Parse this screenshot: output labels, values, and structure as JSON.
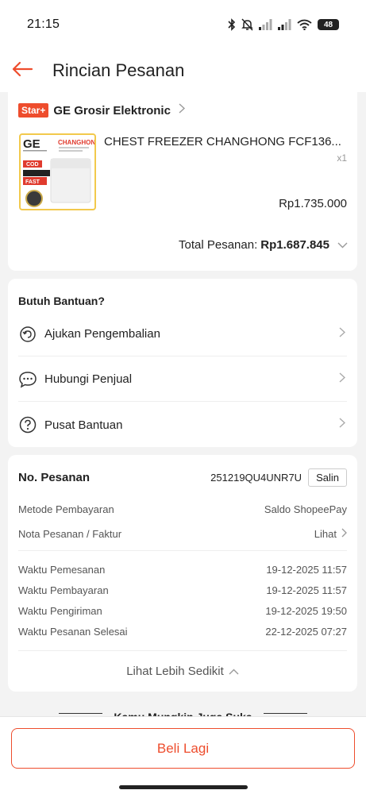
{
  "status_bar": {
    "time": "21:15",
    "battery": "48",
    "icons": [
      "bluetooth-icon",
      "bell-off-icon",
      "signal-icon",
      "signal-icon",
      "wifi-icon",
      "battery-icon"
    ]
  },
  "header": {
    "title": "Rincian Pesanan"
  },
  "shop": {
    "badge": "Star+",
    "name": "GE Grosir Elektronic"
  },
  "product": {
    "name": "CHEST FREEZER CHANGHONG FCF136...",
    "qty": "x1",
    "price": "Rp1.735.000",
    "thumb_brand": "CHANGHONG",
    "thumb_logo": "GE",
    "thumb_cod": "COD",
    "thumb_fast": "FAST"
  },
  "total": {
    "label": "Total Pesanan:",
    "amount": "Rp1.687.845"
  },
  "help": {
    "title": "Butuh Bantuan?",
    "items": [
      {
        "label": "Ajukan Pengembalian",
        "icon": "return-icon"
      },
      {
        "label": "Hubungi Penjual",
        "icon": "chat-icon"
      },
      {
        "label": "Pusat Bantuan",
        "icon": "help-icon"
      }
    ]
  },
  "order": {
    "no_label": "No. Pesanan",
    "no_value": "251219QU4UNR7U",
    "copy_label": "Salin",
    "payment_label": "Metode Pembayaran",
    "payment_value": "Saldo ShopeePay",
    "invoice_label": "Nota Pesanan / Faktur",
    "invoice_value": "Lihat",
    "times": [
      {
        "label": "Waktu Pemesanan",
        "value": "19-12-2025 11:57"
      },
      {
        "label": "Waktu Pembayaran",
        "value": "19-12-2025 11:57"
      },
      {
        "label": "Waktu Pengiriman",
        "value": "19-12-2025 19:50"
      },
      {
        "label": "Waktu Pesanan Selesai",
        "value": "22-12-2025 07:27"
      }
    ],
    "less_label": "Lihat Lebih Sedikit"
  },
  "recommend": {
    "title": "Kamu Mungkin Juga Suka"
  },
  "footer": {
    "buy_again": "Beli Lagi"
  },
  "colors": {
    "accent": "#ee4d2d",
    "badge_border": "#f2c94c"
  }
}
